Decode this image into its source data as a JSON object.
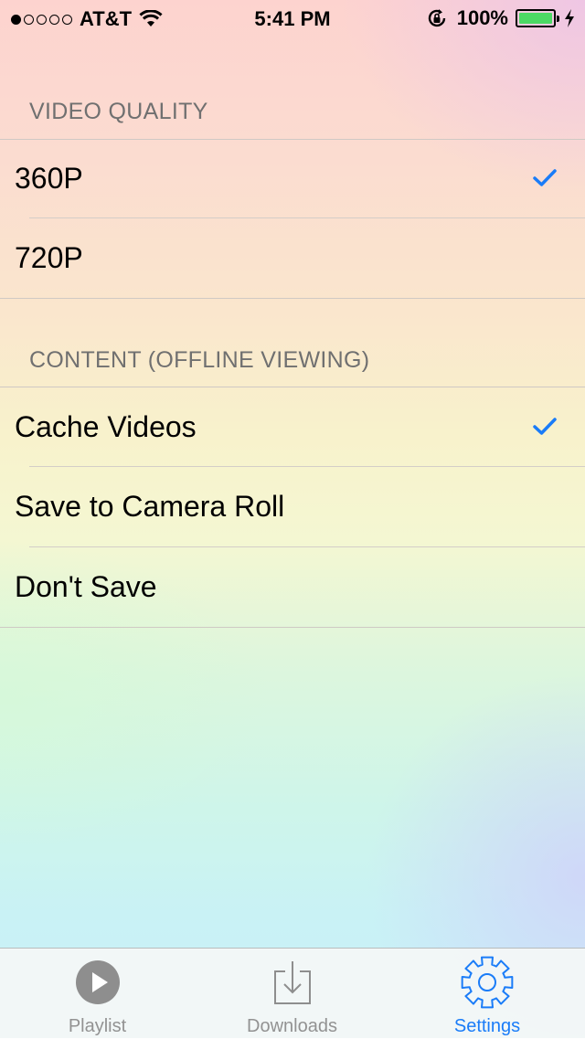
{
  "status_bar": {
    "signal_dots": [
      true,
      false,
      false,
      false,
      false
    ],
    "carrier": "AT&T",
    "time": "5:41 PM",
    "battery_percent": "100%",
    "battery_level": 1.0,
    "icons": [
      "wifi-icon",
      "rotation-lock-icon",
      "battery-icon",
      "charging-bolt-icon"
    ]
  },
  "sections": [
    {
      "header": "VIDEO QUALITY",
      "rows": [
        {
          "label": "360P",
          "checked": true
        },
        {
          "label": "720P",
          "checked": false
        }
      ]
    },
    {
      "header": "CONTENT (OFFLINE VIEWING)",
      "rows": [
        {
          "label": "Cache Videos",
          "checked": true
        },
        {
          "label": "Save to Camera Roll",
          "checked": false
        },
        {
          "label": "Don't Save",
          "checked": false
        }
      ]
    }
  ],
  "tab_bar": {
    "tabs": [
      {
        "label": "Playlist",
        "icon": "play-circle-icon",
        "active": false
      },
      {
        "label": "Downloads",
        "icon": "download-tray-icon",
        "active": false
      },
      {
        "label": "Settings",
        "icon": "gear-icon",
        "active": true
      }
    ]
  },
  "colors": {
    "accent": "#1a7cf8",
    "checkmark": "#1a7cf8",
    "inactive_tab": "#929292",
    "section_header": "#707070",
    "battery_fill": "#4cd964"
  }
}
